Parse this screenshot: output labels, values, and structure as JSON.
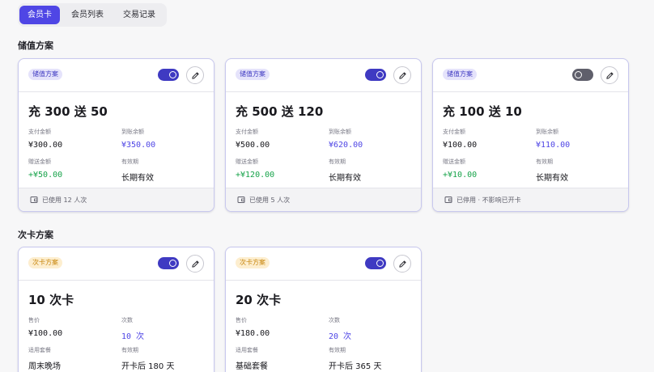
{
  "tabs": [
    {
      "label": "会员卡",
      "active": true
    },
    {
      "label": "会员列表",
      "active": false
    },
    {
      "label": "交易记录",
      "active": false
    }
  ],
  "sections": {
    "stored_value": "储值方案",
    "punch_card": "次卡方案"
  },
  "stored_cards": [
    {
      "badge": "储值方案",
      "toggle": "on",
      "title": "充 300 送 50",
      "f1_label": "支付金额",
      "f1_value": "¥300.00",
      "f2_label": "到账余额",
      "f2_value": "¥350.00",
      "f3_label": "赠送金额",
      "f3_value": "+¥50.00",
      "f4_label": "有效期",
      "f4_value": "长期有效",
      "footer": "已使用 12 人次"
    },
    {
      "badge": "储值方案",
      "toggle": "on",
      "title": "充 500 送 120",
      "f1_label": "支付金额",
      "f1_value": "¥500.00",
      "f2_label": "到账余额",
      "f2_value": "¥620.00",
      "f3_label": "赠送金额",
      "f3_value": "+¥120.00",
      "f4_label": "有效期",
      "f4_value": "长期有效",
      "footer": "已使用 5 人次"
    },
    {
      "badge": "储值方案",
      "toggle": "off",
      "title": "充 100 送 10",
      "f1_label": "支付金额",
      "f1_value": "¥100.00",
      "f2_label": "到账余额",
      "f2_value": "¥110.00",
      "f3_label": "赠送金额",
      "f3_value": "+¥10.00",
      "f4_label": "有效期",
      "f4_value": "长期有效",
      "footer": "已停用 · 不影响已开卡"
    }
  ],
  "punch_cards": [
    {
      "badge": "次卡方案",
      "toggle": "on",
      "title": "10 次卡",
      "f1_label": "售价",
      "f1_value": "¥100.00",
      "f2_label": "次数",
      "f2_value": "10 次",
      "f3_label": "适用套餐",
      "f3_value": "周末晚场",
      "f4_label": "有效期",
      "f4_value": "开卡后 180 天"
    },
    {
      "badge": "次卡方案",
      "toggle": "on",
      "title": "20 次卡",
      "f1_label": "售价",
      "f1_value": "¥180.00",
      "f2_label": "次数",
      "f2_value": "20 次",
      "f3_label": "适用套餐",
      "f3_value": "基础套餐",
      "f4_label": "有效期",
      "f4_value": "开卡后 365 天"
    }
  ],
  "colors": {
    "accent": "#4f46e5",
    "positive": "#17a34a",
    "badge_purple_bg": "#e5e3fb",
    "badge_orange_bg": "#fdeecf"
  },
  "icons": {
    "edit": "pencil-icon",
    "footer": "card-icon"
  }
}
